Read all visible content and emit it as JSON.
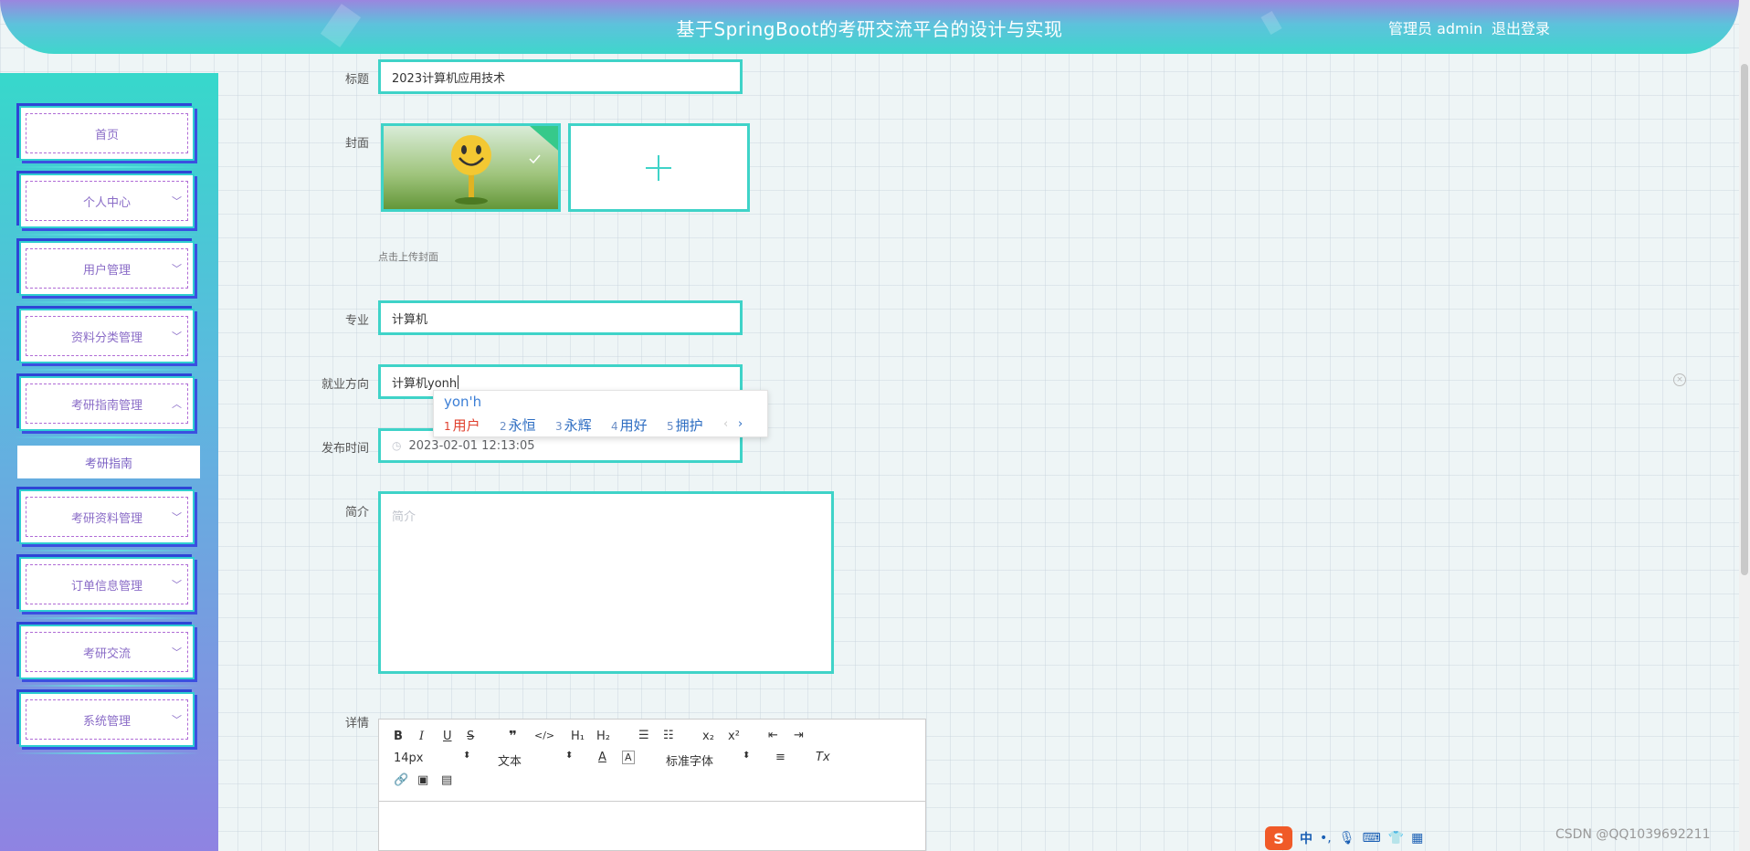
{
  "header": {
    "title": "基于SpringBoot的考研交流平台的设计与实现",
    "user": "管理员 admin",
    "logout": "退出登录"
  },
  "sidebar": {
    "items": [
      {
        "label": "首页",
        "chevron": ""
      },
      {
        "label": "个人中心",
        "chevron": "﹀"
      },
      {
        "label": "用户管理",
        "chevron": "﹀"
      },
      {
        "label": "资料分类管理",
        "chevron": "﹀"
      },
      {
        "label": "考研指南管理",
        "chevron": "︿"
      },
      {
        "label": "考研资料管理",
        "chevron": "﹀"
      },
      {
        "label": "订单信息管理",
        "chevron": "﹀"
      },
      {
        "label": "考研交流",
        "chevron": "﹀"
      },
      {
        "label": "系统管理",
        "chevron": "﹀"
      }
    ],
    "submenu": "考研指南"
  },
  "form": {
    "title_label": "标题",
    "title_value": "2023计算机应用技术",
    "cover_label": "封面",
    "upload_hint": "点击上传封面",
    "major_label": "专业",
    "major_value": "计算机",
    "direction_label": "就业方向",
    "direction_value": "计算机yonh",
    "publish_label": "发布时间",
    "publish_value": "2023-02-01 12:13:05",
    "intro_label": "简介",
    "intro_placeholder": "简介",
    "detail_label": "详情"
  },
  "editor": {
    "font_size": "14px",
    "paragraph": "文本",
    "font_family": "标准字体"
  },
  "ime": {
    "composition": "yon'h",
    "candidates": [
      {
        "n": "1",
        "text": "用户"
      },
      {
        "n": "2",
        "text": "永恒"
      },
      {
        "n": "3",
        "text": "永辉"
      },
      {
        "n": "4",
        "text": "用好"
      },
      {
        "n": "5",
        "text": "拥护"
      }
    ]
  },
  "imebar": {
    "logo": "S",
    "mode": "中"
  },
  "watermark": "CSDN @QQ1039692211",
  "colors": {
    "accent": "#3fd3c8",
    "sidebar_top": "#37d8cb",
    "sidebar_bottom": "#8f83e2"
  }
}
